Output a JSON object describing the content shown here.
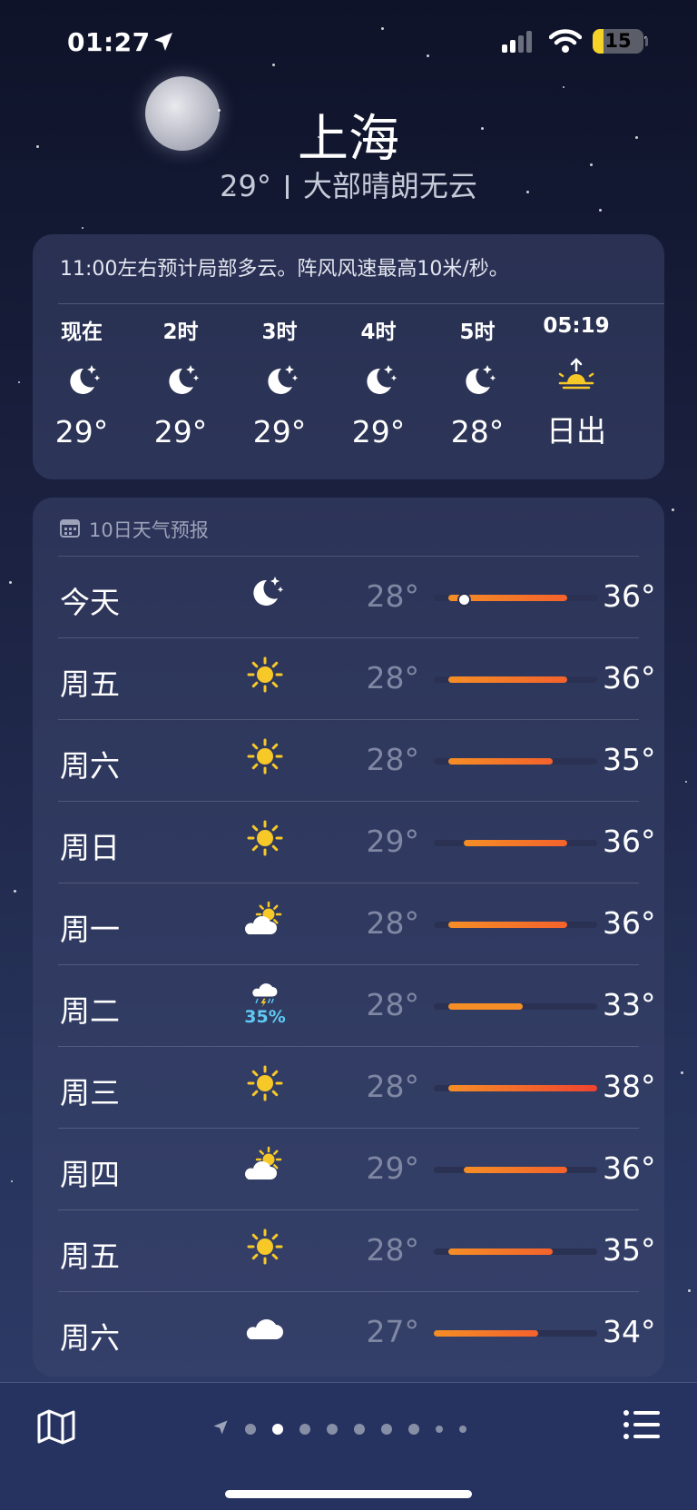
{
  "status_bar": {
    "time": "01:27",
    "battery": "15"
  },
  "header": {
    "city": "上海",
    "temperature": "29°",
    "condition": "大部晴朗无云"
  },
  "hourly": {
    "summary": "11:00左右预计局部多云。阵风风速最高10米/秒。",
    "items": [
      {
        "label": "现在",
        "icon": "moon-stars-icon",
        "temp": "29°"
      },
      {
        "label": "2时",
        "icon": "moon-stars-icon",
        "temp": "29°"
      },
      {
        "label": "3时",
        "icon": "moon-stars-icon",
        "temp": "29°"
      },
      {
        "label": "4时",
        "icon": "moon-stars-icon",
        "temp": "29°"
      },
      {
        "label": "5时",
        "icon": "moon-stars-icon",
        "temp": "28°"
      },
      {
        "label": "05:19",
        "icon": "sunrise-icon",
        "temp": "日出"
      }
    ]
  },
  "daily": {
    "title": "10日天气预报",
    "range_min": 27,
    "range_max": 38,
    "rows": [
      {
        "day": "今天",
        "icon": "moon-stars-icon",
        "precip": "",
        "low": "28°",
        "high": "36°",
        "low_val": 28,
        "high_val": 36,
        "current_val": 29
      },
      {
        "day": "周五",
        "icon": "sun-icon",
        "precip": "",
        "low": "28°",
        "high": "36°",
        "low_val": 28,
        "high_val": 36
      },
      {
        "day": "周六",
        "icon": "sun-icon",
        "precip": "",
        "low": "28°",
        "high": "35°",
        "low_val": 28,
        "high_val": 35
      },
      {
        "day": "周日",
        "icon": "sun-icon",
        "precip": "",
        "low": "29°",
        "high": "36°",
        "low_val": 29,
        "high_val": 36
      },
      {
        "day": "周一",
        "icon": "partly-cloudy-icon",
        "precip": "",
        "low": "28°",
        "high": "36°",
        "low_val": 28,
        "high_val": 36
      },
      {
        "day": "周二",
        "icon": "thunderstorm-icon",
        "precip": "35%",
        "low": "28°",
        "high": "33°",
        "low_val": 28,
        "high_val": 33
      },
      {
        "day": "周三",
        "icon": "sun-icon",
        "precip": "",
        "low": "28°",
        "high": "38°",
        "low_val": 28,
        "high_val": 38
      },
      {
        "day": "周四",
        "icon": "partly-cloudy-icon",
        "precip": "",
        "low": "29°",
        "high": "36°",
        "low_val": 29,
        "high_val": 36
      },
      {
        "day": "周五",
        "icon": "sun-icon",
        "precip": "",
        "low": "28°",
        "high": "35°",
        "low_val": 28,
        "high_val": 35
      },
      {
        "day": "周六",
        "icon": "cloud-icon",
        "precip": "",
        "low": "27°",
        "high": "34°",
        "low_val": 27,
        "high_val": 34
      }
    ]
  },
  "bottom_bar": {
    "map_icon": "map-icon",
    "list_icon": "list-icon",
    "page_count": 9,
    "active_page": 1
  }
}
